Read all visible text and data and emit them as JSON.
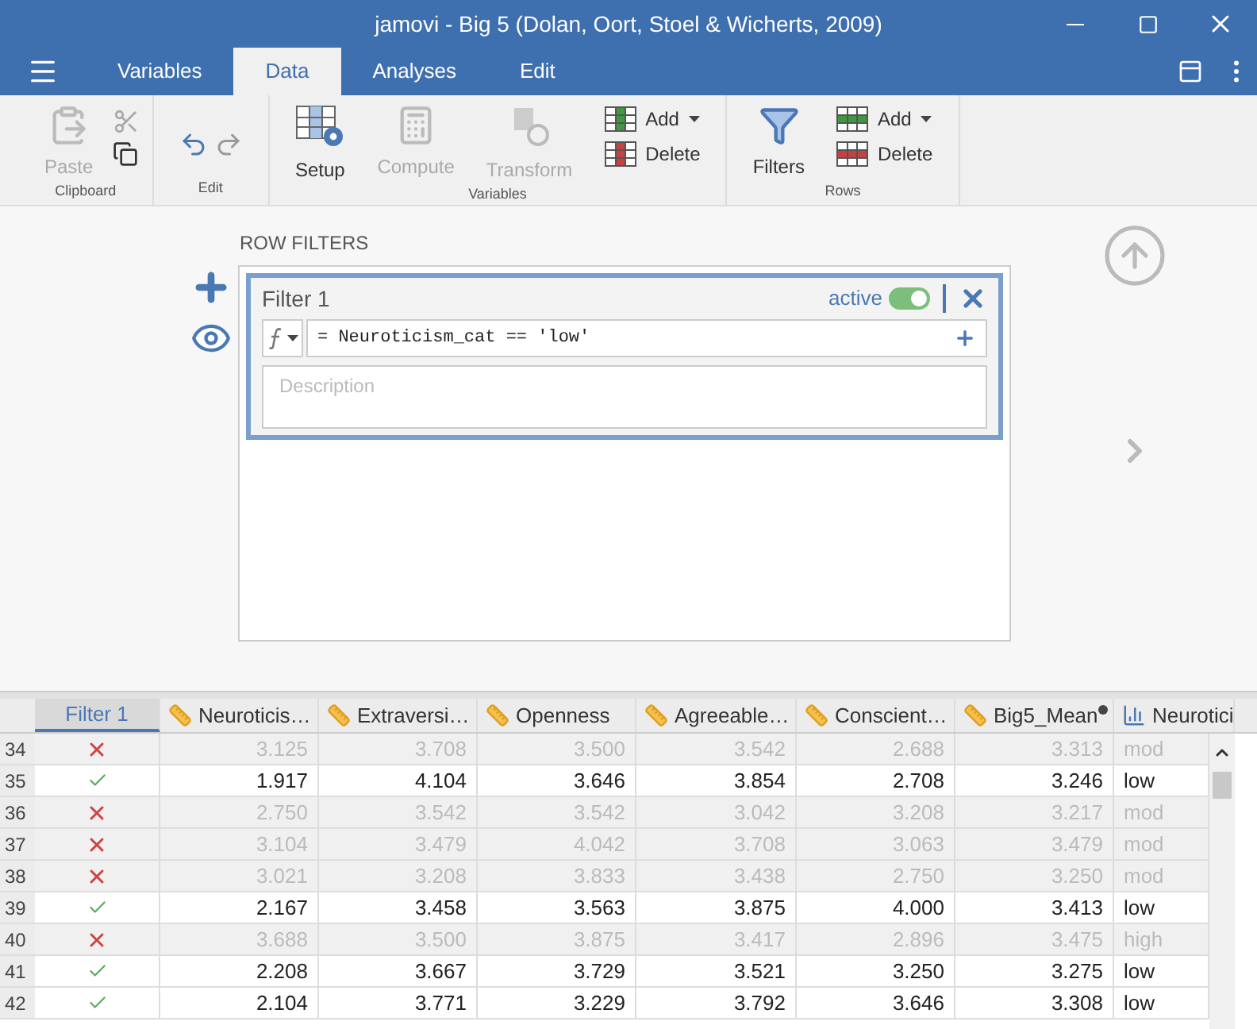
{
  "window": {
    "title": "jamovi - Big 5 (Dolan, Oort, Stoel & Wicherts, 2009)"
  },
  "tabs": [
    {
      "label": "Variables",
      "selected": false
    },
    {
      "label": "Data",
      "selected": true
    },
    {
      "label": "Analyses",
      "selected": false
    },
    {
      "label": "Edit",
      "selected": false
    }
  ],
  "ribbon": [
    {
      "label": "Clipboard",
      "items": [
        {
          "kind": "paste",
          "label": "Paste",
          "disabled": true
        },
        [
          {
            "kind": "cut",
            "disabled": true
          },
          {
            "kind": "copy",
            "disabled": false
          }
        ]
      ]
    },
    {
      "label": "Edit",
      "items": [
        {
          "kind": "undo",
          "disabled": false
        },
        {
          "kind": "redo",
          "disabled": true
        }
      ]
    },
    {
      "label": "Variables",
      "items": [
        {
          "kind": "setup",
          "label": "Setup",
          "disabled": false
        },
        {
          "kind": "compute",
          "label": "Compute",
          "disabled": true
        },
        {
          "kind": "transform",
          "label": "Transform",
          "disabled": true
        },
        {
          "kind": "col-add-delete",
          "add": "Add",
          "delete": "Delete",
          "disabled": false
        }
      ]
    },
    {
      "label": "Rows",
      "items": [
        {
          "kind": "filters",
          "label": "Filters",
          "disabled": false
        },
        {
          "kind": "row-add-delete",
          "add": "Add",
          "delete": "Delete",
          "disabled": false
        }
      ]
    }
  ],
  "filters": {
    "heading": "ROW FILTERS",
    "items": [
      {
        "title": "Filter 1",
        "active_label": "active",
        "active": true,
        "formula": "= Neuroticism_cat == 'low'",
        "description_placeholder": "Description"
      }
    ]
  },
  "table": {
    "filter_column": {
      "label": "Filter 1",
      "selected": true
    },
    "columns": [
      {
        "label": "Neuroticis…",
        "kind": "continuous",
        "selected": false
      },
      {
        "label": "Extraversi…",
        "kind": "continuous",
        "selected": false
      },
      {
        "label": "Openness",
        "kind": "continuous",
        "selected": false
      },
      {
        "label": "Agreeable…",
        "kind": "continuous",
        "selected": false
      },
      {
        "label": "Conscient…",
        "kind": "continuous",
        "selected": false
      },
      {
        "label": "Big5_Mean",
        "kind": "computed",
        "selected": false
      },
      {
        "label": "Neurotici",
        "kind": "nominal",
        "selected": false
      }
    ],
    "rows": [
      {
        "num": "34",
        "included": false,
        "cells": [
          "3.125",
          "3.708",
          "3.500",
          "3.542",
          "2.688",
          "3.313",
          "mod"
        ]
      },
      {
        "num": "35",
        "included": true,
        "cells": [
          "1.917",
          "4.104",
          "3.646",
          "3.854",
          "2.708",
          "3.246",
          "low"
        ]
      },
      {
        "num": "36",
        "included": false,
        "cells": [
          "2.750",
          "3.542",
          "3.542",
          "3.042",
          "3.208",
          "3.217",
          "mod"
        ]
      },
      {
        "num": "37",
        "included": false,
        "cells": [
          "3.104",
          "3.479",
          "4.042",
          "3.708",
          "3.063",
          "3.479",
          "mod"
        ]
      },
      {
        "num": "38",
        "included": false,
        "cells": [
          "3.021",
          "3.208",
          "3.833",
          "3.438",
          "2.750",
          "3.250",
          "mod"
        ]
      },
      {
        "num": "39",
        "included": true,
        "cells": [
          "2.167",
          "3.458",
          "3.563",
          "3.875",
          "4.000",
          "3.413",
          "low"
        ]
      },
      {
        "num": "40",
        "included": false,
        "cells": [
          "3.688",
          "3.500",
          "3.875",
          "3.417",
          "2.896",
          "3.475",
          "high"
        ]
      },
      {
        "num": "41",
        "included": true,
        "cells": [
          "2.208",
          "3.667",
          "3.729",
          "3.521",
          "3.250",
          "3.275",
          "low"
        ]
      },
      {
        "num": "42",
        "included": true,
        "cells": [
          "2.104",
          "3.771",
          "3.229",
          "3.792",
          "3.646",
          "3.308",
          "low"
        ]
      }
    ]
  }
}
